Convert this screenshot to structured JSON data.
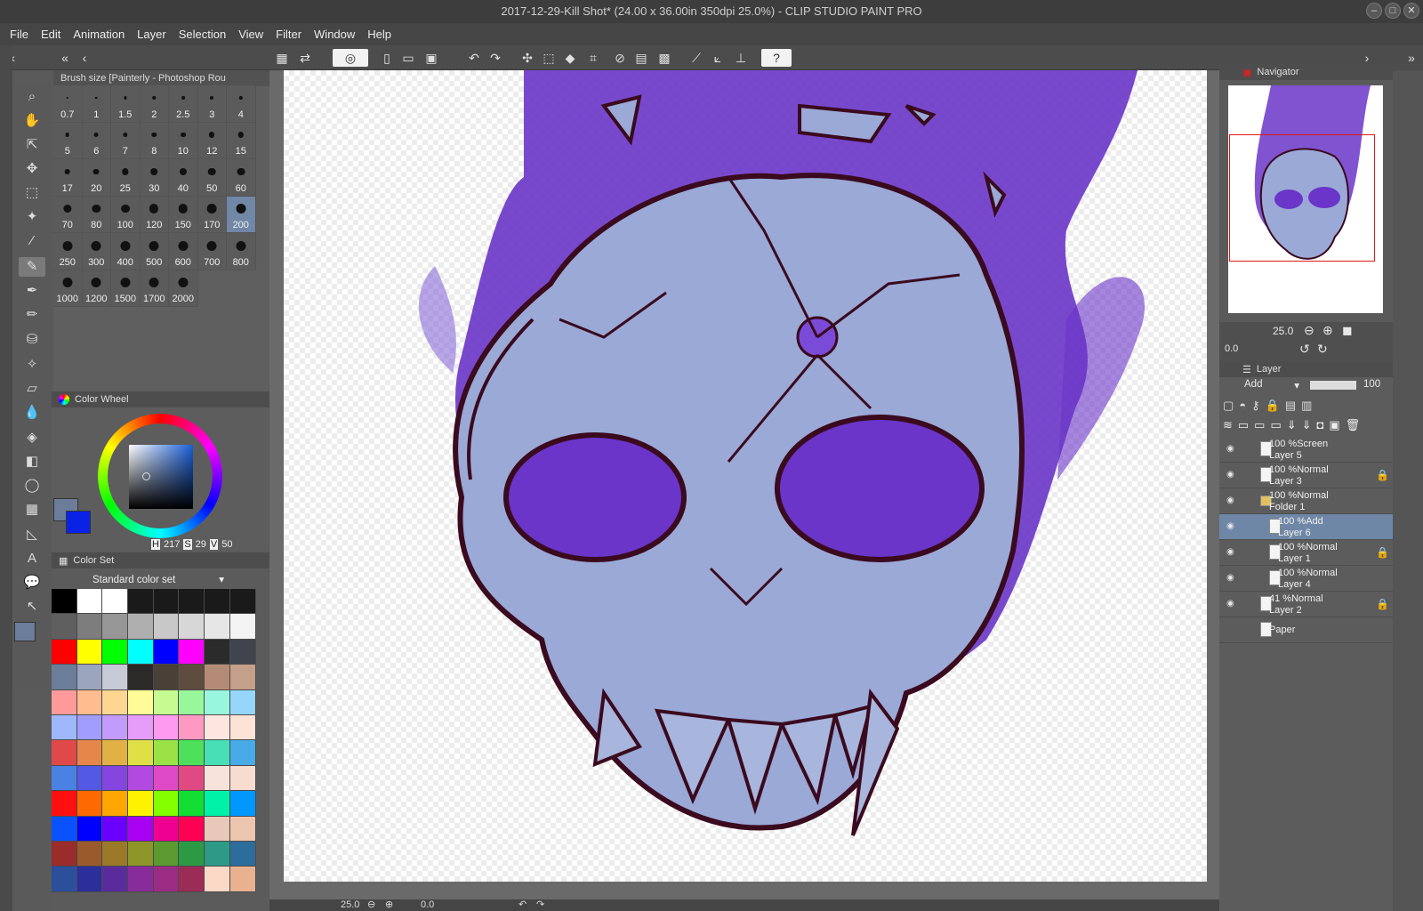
{
  "title": "2017-12-29-Kill Shot* (24.00 x 36.00in 350dpi 25.0%)  - CLIP STUDIO PAINT PRO",
  "menu": [
    "File",
    "Edit",
    "Animation",
    "Layer",
    "Selection",
    "View",
    "Filter",
    "Window",
    "Help"
  ],
  "brush_panel": {
    "title": "Brush size [Painterly - Photoshop Rou",
    "sizes": [
      "0.7",
      "1",
      "1.5",
      "2",
      "2.5",
      "3",
      "4",
      "5",
      "6",
      "7",
      "8",
      "10",
      "12",
      "15",
      "17",
      "20",
      "25",
      "30",
      "40",
      "50",
      "60",
      "70",
      "80",
      "100",
      "120",
      "150",
      "170",
      "200",
      "250",
      "300",
      "400",
      "500",
      "600",
      "700",
      "800",
      "1000",
      "1200",
      "1500",
      "1700",
      "2000"
    ],
    "selected": "200"
  },
  "color_wheel": {
    "title": "Color Wheel",
    "h_label": "H",
    "h": "217",
    "s_label": "S",
    "s": "29",
    "v_label": "V",
    "v": "50",
    "main_color": "#6b7d99",
    "sub_color": "#0a22e6"
  },
  "color_set": {
    "title": "Color Set",
    "set_name": "Standard color set",
    "colors": [
      "#000000",
      "#ffffff",
      "#ffffff",
      "#1a1a1a",
      "#1a1a1a",
      "#1a1a1a",
      "#1a1a1a",
      "#1a1a1a",
      "#5f5f5f",
      "#7d7d7d",
      "#969696",
      "#afafaf",
      "#c8c8c8",
      "#d7d7d7",
      "#e6e6e6",
      "#f4f4f4",
      "#ff0000",
      "#ffff00",
      "#00ff00",
      "#00ffff",
      "#0000ff",
      "#ff00ff",
      "#2b2b2b",
      "#40444d",
      "#6b7d99",
      "#9aa5be",
      "#c7cbd8",
      "#2c2a29",
      "#4a4038",
      "#5e4c3f",
      "#b48b74",
      "#c3a08a",
      "#ff9a9a",
      "#ffbc8f",
      "#ffd592",
      "#fffb96",
      "#c6fb91",
      "#99f79b",
      "#98f6de",
      "#96d6fd",
      "#9fb7fb",
      "#a09dfd",
      "#c39bfb",
      "#e69cf9",
      "#fe9bf1",
      "#fe9ac1",
      "#fde6e0",
      "#fde3d6",
      "#e04949",
      "#e5874a",
      "#e1b146",
      "#dfe046",
      "#9be247",
      "#4de05a",
      "#47dfb5",
      "#48aae6",
      "#4a82e3",
      "#5358e5",
      "#8446de",
      "#b249e0",
      "#de49c5",
      "#e04a83",
      "#f7e3dc",
      "#f8dccf",
      "#ff1010",
      "#ff6a00",
      "#ffa600",
      "#fff200",
      "#84ff00",
      "#11dd33",
      "#00f2a8",
      "#0098ff",
      "#0a52ff",
      "#0000ff",
      "#6a00ff",
      "#a700f2",
      "#f00090",
      "#ff0055",
      "#e8c8b8",
      "#edc6b0",
      "#9a2c2c",
      "#9b5a2c",
      "#9a7a28",
      "#8e962a",
      "#5a9a2e",
      "#2c9a45",
      "#2c9a87",
      "#2d6d9b",
      "#2c4f9b",
      "#2c2e9b",
      "#5a2c9b",
      "#882c9b",
      "#9b2c84",
      "#9b2c55",
      "#fcd9c6",
      "#e8b290"
    ]
  },
  "navigator": {
    "title": "Navigator",
    "zoom": "25.0",
    "rotation": "0.0"
  },
  "layers": {
    "title": "Layer",
    "blend_mode": "Add",
    "opacity": "100",
    "rows": [
      {
        "percent": "100 %",
        "mode": "Screen",
        "name": "Layer 5"
      },
      {
        "percent": "100 %",
        "mode": "Normal",
        "name": "Layer 3"
      },
      {
        "percent": "100 %",
        "mode": "Normal",
        "name": "Folder 1"
      },
      {
        "percent": "100 %",
        "mode": "Add",
        "name": "Layer 6"
      },
      {
        "percent": "100 %",
        "mode": "Normal",
        "name": "Layer 1"
      },
      {
        "percent": "100 %",
        "mode": "Normal",
        "name": "Layer 4"
      },
      {
        "percent": "41 %",
        "mode": "Normal",
        "name": "Layer 2"
      },
      {
        "percent": "",
        "mode": "",
        "name": "Paper"
      }
    ]
  },
  "status": {
    "zoom": "25.0",
    "angle": "0.0"
  },
  "canvas": {
    "subject": "skull-illustration",
    "flame_color": "#6a35c8",
    "bone_color": "#9aa9d6",
    "outline_color": "#3a0a1e"
  }
}
